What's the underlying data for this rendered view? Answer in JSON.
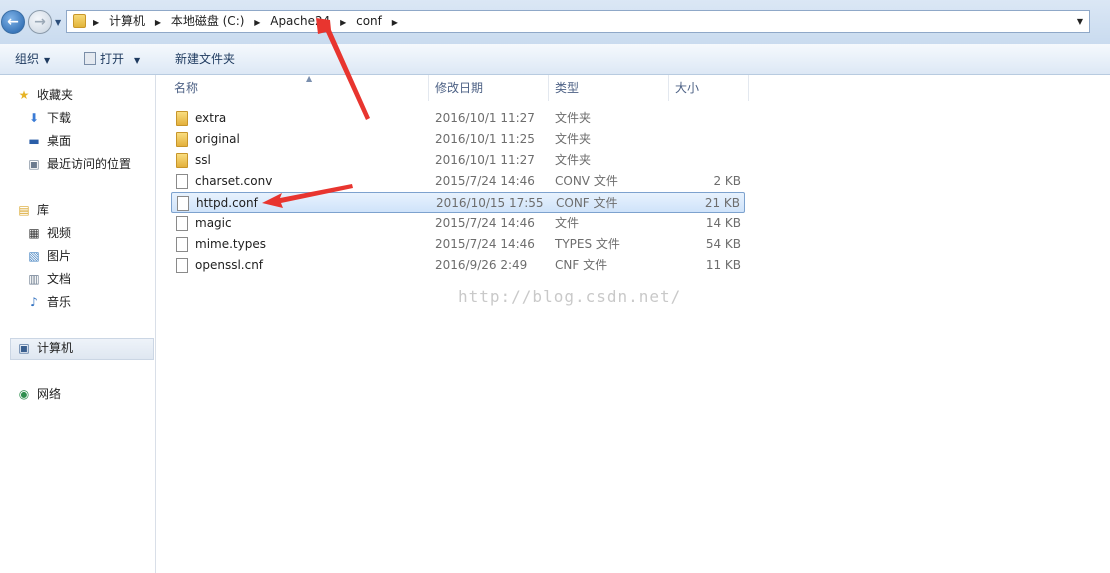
{
  "address_bar": {
    "crumbs": [
      "计算机",
      "本地磁盘 (C:)",
      "Apache24",
      "conf"
    ]
  },
  "toolbar": {
    "organize_label": "组织",
    "open_label": "打开",
    "new_folder_label": "新建文件夹"
  },
  "nav": {
    "favorites": "收藏夹",
    "downloads": "下载",
    "desktop": "桌面",
    "recent": "最近访问的位置",
    "libraries": "库",
    "videos": "视频",
    "pictures": "图片",
    "documents": "文档",
    "music": "音乐",
    "computer": "计算机",
    "network": "网络"
  },
  "columns": {
    "name": "名称",
    "modified": "修改日期",
    "type": "类型",
    "size": "大小"
  },
  "files": [
    {
      "name": "extra",
      "date": "2016/10/1 11:27",
      "type": "文件夹",
      "size": "",
      "kind": "folder"
    },
    {
      "name": "original",
      "date": "2016/10/1 11:25",
      "type": "文件夹",
      "size": "",
      "kind": "folder"
    },
    {
      "name": "ssl",
      "date": "2016/10/1 11:27",
      "type": "文件夹",
      "size": "",
      "kind": "folder"
    },
    {
      "name": "charset.conv",
      "date": "2015/7/24 14:46",
      "type": "CONV 文件",
      "size": "2 KB",
      "kind": "file"
    },
    {
      "name": "httpd.conf",
      "date": "2016/10/15 17:55",
      "type": "CONF 文件",
      "size": "21 KB",
      "kind": "file",
      "selected": true
    },
    {
      "name": "magic",
      "date": "2015/7/24 14:46",
      "type": "文件",
      "size": "14 KB",
      "kind": "file"
    },
    {
      "name": "mime.types",
      "date": "2015/7/24 14:46",
      "type": "TYPES 文件",
      "size": "54 KB",
      "kind": "file"
    },
    {
      "name": "openssl.cnf",
      "date": "2016/9/26 2:49",
      "type": "CNF 文件",
      "size": "11 KB",
      "kind": "file"
    }
  ],
  "watermark": "http://blog.csdn.net/",
  "colors": {
    "annotation_arrow": "#e8352f",
    "selection": "#cfe3fa"
  }
}
